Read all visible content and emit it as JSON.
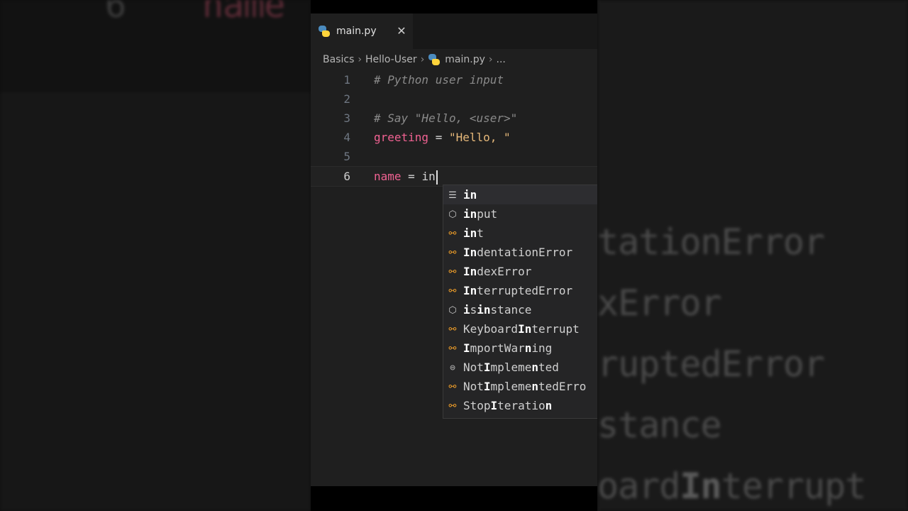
{
  "background": {
    "left_top_number": "6",
    "left_top_name": "name",
    "right_lines": [
      {
        "pre": "",
        "bold": "",
        "post": "tationError"
      },
      {
        "pre": "",
        "bold": "",
        "post": "xError"
      },
      {
        "pre": "",
        "bold": "",
        "post": "ruptedError"
      },
      {
        "pre": "",
        "bold": "",
        "post": "stance"
      },
      {
        "pre": "oard",
        "bold": "In",
        "post": "terrupt"
      }
    ]
  },
  "tab": {
    "filename": "main.py",
    "close": "✕"
  },
  "breadcrumb": {
    "items": [
      "Basics",
      "Hello-User",
      "main.py",
      "..."
    ]
  },
  "code": {
    "lines": [
      {
        "num": "1",
        "comment": "# Python user input"
      },
      {
        "num": "2"
      },
      {
        "num": "3",
        "comment": "# Say \"Hello, <user>\""
      },
      {
        "num": "4",
        "var": "greeting",
        "op": " = ",
        "str": "\"Hello, \""
      },
      {
        "num": "5"
      },
      {
        "num": "6",
        "var": "name",
        "op": " = ",
        "typed": "in"
      }
    ]
  },
  "suggestions": [
    {
      "kind": "keyword",
      "pre": "",
      "bold": "in",
      "post": ""
    },
    {
      "kind": "function",
      "pre": "",
      "bold": "in",
      "post": "put"
    },
    {
      "kind": "class",
      "pre": "",
      "bold": "in",
      "post": "t"
    },
    {
      "kind": "class",
      "pre": "",
      "bold": "In",
      "post": "dentationError"
    },
    {
      "kind": "class",
      "pre": "",
      "bold": "In",
      "post": "dexError"
    },
    {
      "kind": "class",
      "pre": "",
      "bold": "In",
      "post": "terruptedError"
    },
    {
      "kind": "function",
      "pre": "",
      "bold": "i",
      "post": "s",
      "bold2": "in",
      "post2": "stance"
    },
    {
      "kind": "class",
      "pre": "Keyboard",
      "bold": "In",
      "post": "terrupt"
    },
    {
      "kind": "class",
      "pre": "",
      "bold": "I",
      "post": "mportWar",
      "bold2": "n",
      "post2": "ing"
    },
    {
      "kind": "constant",
      "pre": "Not",
      "bold": "I",
      "post": "mpleme",
      "bold2": "n",
      "post2": "ted"
    },
    {
      "kind": "class",
      "pre": "Not",
      "bold": "I",
      "post": "mpleme",
      "bold2": "n",
      "post2": "tedErro"
    },
    {
      "kind": "class",
      "pre": "Stop",
      "bold": "I",
      "post": "teratio",
      "bold2": "n",
      "post2": ""
    }
  ],
  "colors": {
    "editor_bg": "#1f1f1f",
    "variable": "#f06292",
    "string": "#e6b87a",
    "comment": "#8a8a8a",
    "class_icon": "#ee9d28"
  }
}
